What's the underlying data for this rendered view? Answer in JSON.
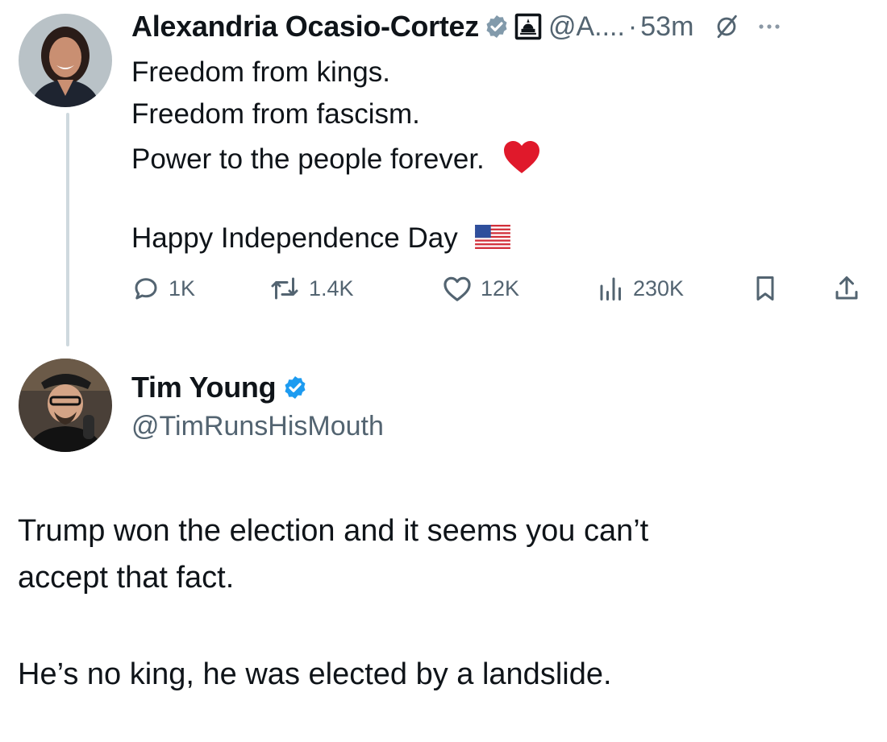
{
  "original_tweet": {
    "author": {
      "display_name": "Alexandria Ocasio-Cortez",
      "handle": "@A....",
      "separator": "·",
      "timestamp": "53m",
      "verified_badge_color": "#829aab",
      "affiliation_icon": "capitol-building-icon"
    },
    "text_lines": [
      "Freedom from kings.",
      "Freedom from fascism.",
      "Power to the people forever.",
      "Happy Independence Day"
    ],
    "emoji": {
      "heart": "red-heart-emoji",
      "flag": "us-flag-emoji"
    },
    "actions": {
      "replies": "1K",
      "reposts": "1.4K",
      "likes": "12K",
      "views": "230K"
    }
  },
  "reply_tweet": {
    "author": {
      "display_name": "Tim Young",
      "handle": "@TimRunsHisMouth",
      "verified_badge_color": "#1d9bf0"
    },
    "text_lines": [
      "Trump won the election and it seems you can’t",
      "accept that fact.",
      "He’s no king, he was elected by a landslide."
    ]
  },
  "colors": {
    "text_primary": "#0f1419",
    "text_secondary": "#536471",
    "thread_line": "#cfd9de",
    "heart": "#e0192b"
  }
}
